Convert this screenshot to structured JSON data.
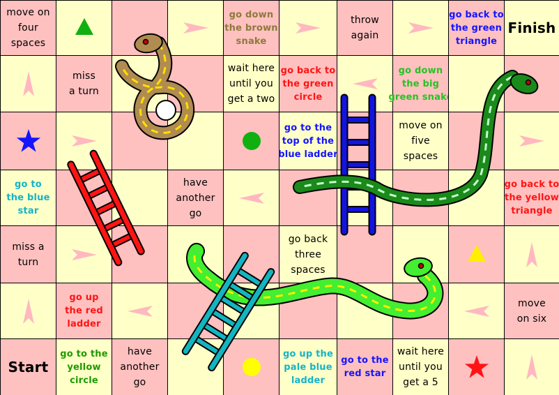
{
  "colors": {
    "pink": "#ffc0c0",
    "yellow": "#ffffc8",
    "arrow": "#ffb8c0",
    "brown": "#8b7a3c",
    "blue": "#1414ff",
    "red": "#ff1414",
    "green": "#22c422",
    "dark_green": "#1e9a00",
    "cyan": "#14b4c8",
    "black": "#000000"
  },
  "board": {
    "rows": [
      {
        "cells": [
          {
            "lines": [
              "move on",
              "four",
              "spaces"
            ],
            "color": "black"
          },
          {
            "icon": "triangle",
            "icon_color": "#10b010"
          },
          {},
          {
            "icon": "arrow",
            "dir": "right"
          },
          {
            "lines": [
              "go down",
              "the brown",
              "snake"
            ],
            "color": "brown"
          },
          {
            "icon": "arrow",
            "dir": "right"
          },
          {
            "lines": [
              "throw",
              "again"
            ],
            "color": "black"
          },
          {
            "icon": "arrow",
            "dir": "right"
          },
          {
            "lines": [
              "go back to",
              "the green",
              "triangle"
            ],
            "color": "blue"
          },
          {
            "lines": [
              "Finish"
            ],
            "color": "black",
            "big": true
          }
        ]
      },
      {
        "cells": [
          {
            "icon": "arrow",
            "dir": "up"
          },
          {
            "lines": [
              "miss",
              "a turn"
            ],
            "color": "black"
          },
          {},
          {},
          {
            "lines": [
              "wait here",
              "until you",
              "get a two"
            ],
            "color": "black"
          },
          {
            "lines": [
              "go back to",
              "the green",
              "circle"
            ],
            "color": "red"
          },
          {
            "icon": "arrow",
            "dir": "left"
          },
          {
            "lines": [
              "go down",
              "the big",
              "green snake"
            ],
            "color": "green"
          },
          {},
          {}
        ]
      },
      {
        "cells": [
          {
            "icon": "star",
            "icon_color": "#1414ff"
          },
          {
            "icon": "arrow",
            "dir": "right"
          },
          {},
          {},
          {
            "icon": "circle",
            "icon_color": "#10b010"
          },
          {
            "lines": [
              "go to the",
              "top of the",
              "blue ladder"
            ],
            "color": "blue"
          },
          {},
          {
            "lines": [
              "move on",
              "five",
              "spaces"
            ],
            "color": "black"
          },
          {},
          {
            "icon": "arrow",
            "dir": "right"
          }
        ]
      },
      {
        "cells": [
          {
            "lines": [
              "go to",
              "the blue",
              "star"
            ],
            "color": "cyan"
          },
          {},
          {},
          {
            "lines": [
              "have",
              "another",
              "go"
            ],
            "color": "black"
          },
          {
            "icon": "arrow",
            "dir": "left"
          },
          {},
          {},
          {},
          {},
          {
            "lines": [
              "go back to",
              "the yellow",
              "triangle"
            ],
            "color": "red"
          }
        ]
      },
      {
        "cells": [
          {
            "lines": [
              "miss a",
              "turn"
            ],
            "color": "black"
          },
          {
            "icon": "arrow",
            "dir": "right"
          },
          {},
          {},
          {},
          {
            "lines": [
              "go back",
              "three",
              "spaces"
            ],
            "color": "black"
          },
          {},
          {},
          {
            "icon": "triangle",
            "icon_color": "#ffee00"
          },
          {
            "icon": "arrow",
            "dir": "up"
          }
        ]
      },
      {
        "cells": [
          {
            "icon": "arrow",
            "dir": "up"
          },
          {
            "lines": [
              "go up",
              "the red",
              "ladder"
            ],
            "color": "red"
          },
          {
            "icon": "arrow",
            "dir": "left"
          },
          {},
          {},
          {},
          {},
          {},
          {
            "icon": "arrow",
            "dir": "left"
          },
          {
            "lines": [
              "move",
              "on six"
            ],
            "color": "black"
          }
        ]
      },
      {
        "cells": [
          {
            "lines": [
              "Start"
            ],
            "color": "black",
            "big": true
          },
          {
            "lines": [
              "go to the",
              "yellow",
              "circle"
            ],
            "color": "dark_green"
          },
          {
            "lines": [
              "have",
              "another",
              "go"
            ],
            "color": "black"
          },
          {},
          {
            "icon": "circle",
            "icon_color": "#ffff00"
          },
          {
            "lines": [
              "go up the",
              "pale blue",
              "ladder"
            ],
            "color": "cyan"
          },
          {
            "lines": [
              "go to the",
              "red star"
            ],
            "color": "blue"
          },
          {
            "lines": [
              "wait here",
              "until you",
              "get a 5"
            ],
            "color": "black"
          },
          {
            "icon": "star",
            "icon_color": "#ff1414"
          },
          {
            "icon": "arrow",
            "dir": "up"
          }
        ]
      }
    ]
  },
  "ladders": [
    {
      "name": "red-ladder",
      "color": "#ff1414"
    },
    {
      "name": "blue-ladder",
      "color": "#1414e0"
    },
    {
      "name": "pale-blue-ladder",
      "color": "#14b4c0"
    }
  ],
  "snakes": [
    {
      "name": "brown-snake",
      "color": "#b08c50"
    },
    {
      "name": "big-green-snake",
      "color": "#1a8a1a"
    },
    {
      "name": "small-green-snake",
      "color": "#44ee30"
    }
  ]
}
